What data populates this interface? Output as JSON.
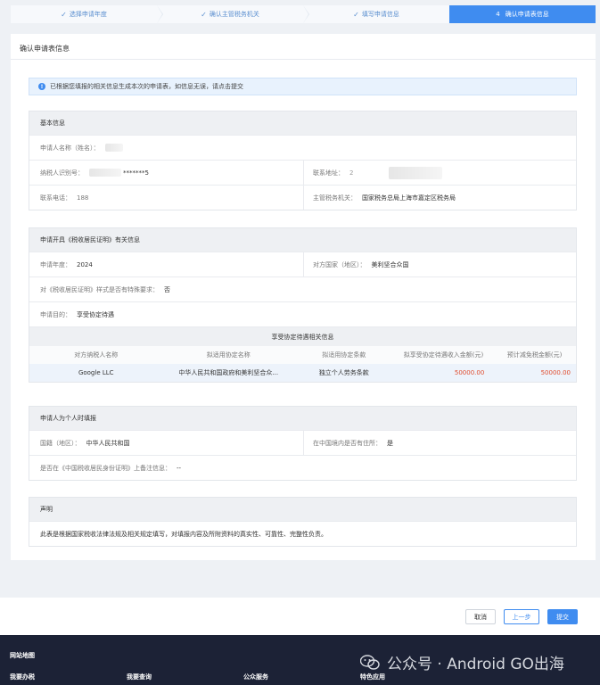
{
  "steps": [
    {
      "label": "选择申请年度",
      "done": true
    },
    {
      "label": "确认主管税务机关",
      "done": true
    },
    {
      "label": "填写申请信息",
      "done": true
    },
    {
      "number": "4",
      "label": "确认申请表信息",
      "active": true
    }
  ],
  "page_title": "确认申请表信息",
  "notice": "已根据您填报的相关信息生成本次的申请表，如信息无误，请点击提交",
  "basic": {
    "head": "基本信息",
    "name_label": "申请人名称（姓名）：",
    "taxid_label": "纳税人识别号：",
    "taxid_value": "*******5",
    "address_label": "联系地址：",
    "address_value": "2",
    "phone_label": "联系电话：",
    "phone_value": "188",
    "authority_label": "主管税务机关：",
    "authority_value": "国家税务总局上海市嘉定区税务局"
  },
  "cert": {
    "head": "申请开具《税收居民证明》有关信息",
    "year_label": "申请年度：",
    "year_value": "2024",
    "country_label": "对方国家（地区）：",
    "country_value": "美利坚合众国",
    "format_label": "对《税收居民证明》样式是否有特殊要求：",
    "format_value": "否",
    "purpose_label": "申请目的：",
    "purpose_value": "享受协定待遇",
    "treaty_head": "享受协定待遇相关信息",
    "columns": [
      "对方纳税人名称",
      "拟适用协定名称",
      "拟适用协定条款",
      "拟享受协定待遇收入金额(元)",
      "预计减免税金额(元)"
    ],
    "rows": [
      [
        "Google LLC",
        "中华人民共和国政府和美利坚合众...",
        "独立个人劳务条款",
        "50000.00",
        "50000.00"
      ]
    ]
  },
  "personal": {
    "head": "申请人为个人时填报",
    "nationality_label": "国籍（地区）：",
    "nationality_value": "中华人民共和国",
    "residence_label": "在中国境内是否有住所：",
    "residence_value": "是",
    "remark_label": "是否在《中国税收居民身份证明》上备注信息：",
    "remark_value": "--"
  },
  "declaration": {
    "head": "声明",
    "text": "此表是根据国家税收法律法规及相关规定填写，对填报内容及所附资料的真实性、可靠性、完整性负责。"
  },
  "buttons": {
    "cancel": "取消",
    "prev": "上一步",
    "submit": "提交"
  },
  "footer": {
    "title": "网站地图",
    "links": [
      "我要办税",
      "我要查询",
      "公众服务",
      "特色应用"
    ],
    "watermark": "公众号 · Android GO出海"
  },
  "colors": {
    "accent": "#3f8cf0",
    "amount": "#e04b2d",
    "footer_bg": "#1c2236"
  }
}
